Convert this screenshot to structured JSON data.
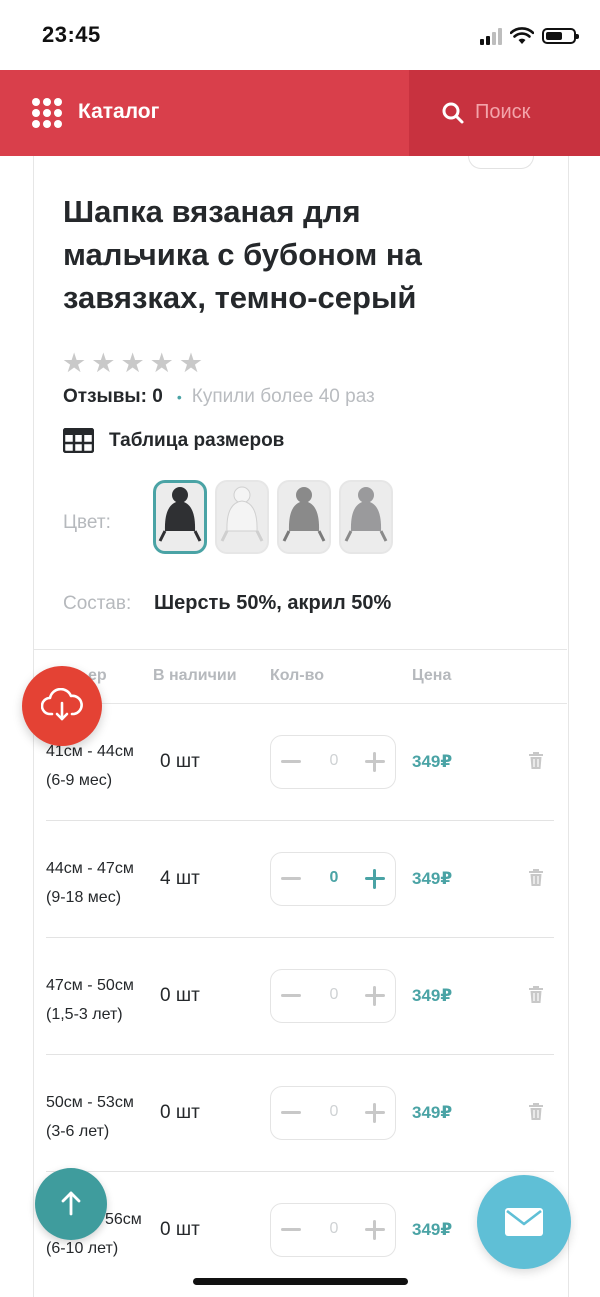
{
  "status_bar": {
    "time": "23:45"
  },
  "header": {
    "catalog_label": "Каталог",
    "search_label": "Поиск"
  },
  "product": {
    "title": "Шапка вязаная для мальчика с бубоном на завязках, темно-серый",
    "rating_stars": 0,
    "reviews_label": "Отзывы: 0",
    "bought_label": "Купили более 40 раз",
    "size_table_label": "Таблица размеров",
    "color_label": "Цвет:",
    "colors": [
      {
        "name": "dark-gray",
        "hex": "#2f3033",
        "selected": true
      },
      {
        "name": "white",
        "hex": "#e9e9e9",
        "selected": false
      },
      {
        "name": "gray",
        "hex": "#8a8a8a",
        "selected": false
      },
      {
        "name": "light-gray",
        "hex": "#9a9a9c",
        "selected": false
      }
    ],
    "composition_label": "Состав:",
    "composition_value": "Шерсть 50%, акрил 50%"
  },
  "table": {
    "headers": [
      "ер",
      "В наличии",
      "Кол-во",
      "Цена"
    ],
    "rows": [
      {
        "size": "41см - 44см",
        "age": "(6-9 мес)",
        "stock": "0 шт",
        "qty": "0",
        "price": "349₽"
      },
      {
        "size": "44см - 47см",
        "age": "(9-18 мес)",
        "stock": "4 шт",
        "qty": "0",
        "price": "349₽"
      },
      {
        "size": "47см - 50см",
        "age": "(1,5-3 лет)",
        "stock": "0 шт",
        "qty": "0",
        "price": "349₽"
      },
      {
        "size": "50см - 53см",
        "age": "(3-6 лет)",
        "stock": "0 шт",
        "qty": "0",
        "price": "349₽"
      },
      {
        "size": "56см",
        "age": "(6-10 лет)",
        "stock": "0 шт",
        "qty": "0",
        "price": "349₽"
      }
    ]
  },
  "colors": {
    "brand_red": "#d93f4b",
    "accent_teal": "#4aa3a5",
    "fab_red": "#e44234",
    "mail_blue": "#5fbfd6"
  }
}
